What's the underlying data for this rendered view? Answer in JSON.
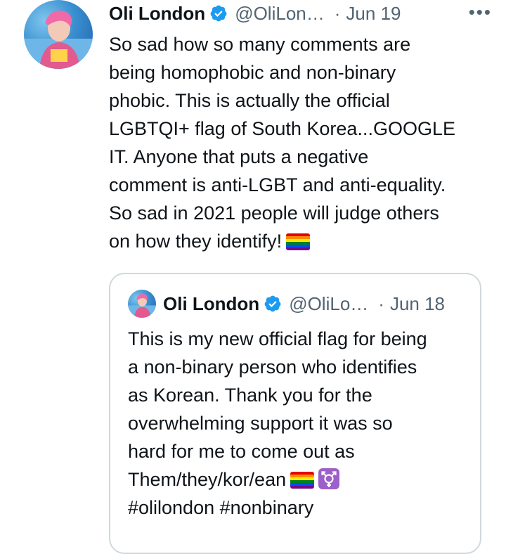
{
  "tweet": {
    "author_name": "Oli London",
    "handle": "@OliLon…",
    "separator": "·",
    "date": "Jun 19",
    "more_label": "•••",
    "text": "So sad how so many comments are\nbeing homophobic and non-binary\nphobic. This is actually the official\nLGBTQI+ flag of South Korea...GOOGLE\nIT. Anyone that puts a negative\ncomment is anti-LGBT and anti-equality.\nSo sad in 2021 people will judge others\non how they identify!",
    "emoji": "rainbow-flag-icon"
  },
  "quoted_tweet": {
    "author_name": "Oli London",
    "handle": "@OliLo…",
    "separator": "·",
    "date": "Jun 18",
    "text_main": "This is my new official flag for being\na non-binary person who identifies\nas Korean.  Thank you for the\noverwhelming support it was so\nhard for me to come out as\nThem/they/kor/ean",
    "hashtags": "#olilondon #nonbinary",
    "emojis": [
      "rainbow-flag-icon",
      "transgender-symbol-icon"
    ]
  },
  "colors": {
    "text": "#0f1419",
    "secondary": "#536471",
    "verified": "#1d9bf0",
    "border": "#cfd9de"
  }
}
